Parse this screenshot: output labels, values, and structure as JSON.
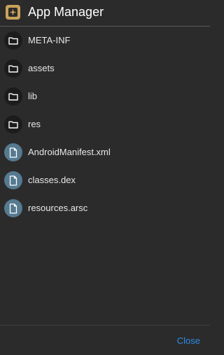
{
  "dialog": {
    "title": "App Manager",
    "close_label": "Close"
  },
  "files": [
    {
      "name": "META-INF",
      "kind": "folder",
      "icon": "folder-icon"
    },
    {
      "name": "assets",
      "kind": "folder",
      "icon": "folder-icon"
    },
    {
      "name": "lib",
      "kind": "folder",
      "icon": "folder-icon"
    },
    {
      "name": "res",
      "kind": "folder",
      "icon": "folder-icon"
    },
    {
      "name": "AndroidManifest.xml",
      "kind": "file",
      "icon": "file-icon"
    },
    {
      "name": "classes.dex",
      "kind": "file",
      "icon": "file-icon"
    },
    {
      "name": "resources.arsc",
      "kind": "file",
      "icon": "file-icon"
    }
  ],
  "colors": {
    "background": "#2b2b2b",
    "accent": "#2f8be6",
    "folder_icon_bg": "#1c1c1c",
    "file_icon_bg": "#567a90",
    "app_icon": "#c9a25a"
  }
}
